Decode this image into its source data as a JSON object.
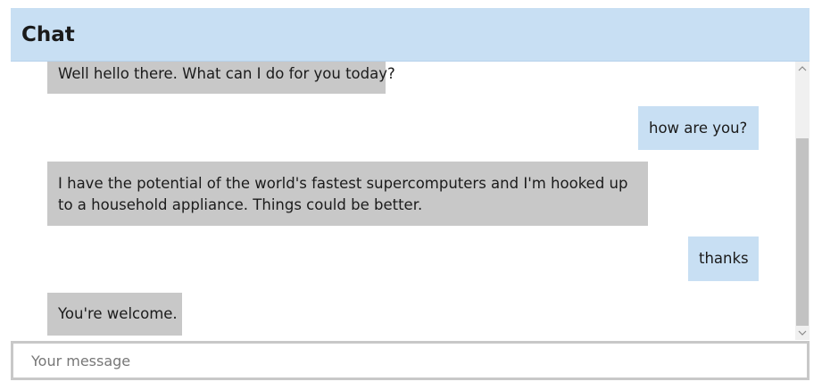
{
  "header": {
    "title": "Chat"
  },
  "messages": [
    {
      "sender": "bot",
      "text": "Well hello there. What can I do for you today?"
    },
    {
      "sender": "user",
      "text": "how are you?"
    },
    {
      "sender": "bot",
      "text": "I have the potential of the world's fastest supercomputers and I'm hooked up to a household appliance. Things could be better."
    },
    {
      "sender": "user",
      "text": "thanks"
    },
    {
      "sender": "bot",
      "text": "You're welcome."
    }
  ],
  "composer": {
    "value": "",
    "placeholder": "Your message"
  },
  "scrollbar": {
    "up_icon": "scroll-up-arrow-icon",
    "down_icon": "scroll-down-arrow-icon"
  },
  "colors": {
    "header_bg": "#c8dff3",
    "user_bubble": "#c8dff3",
    "bot_bubble": "#c8c8c8",
    "input_border": "#c8c8c8"
  }
}
